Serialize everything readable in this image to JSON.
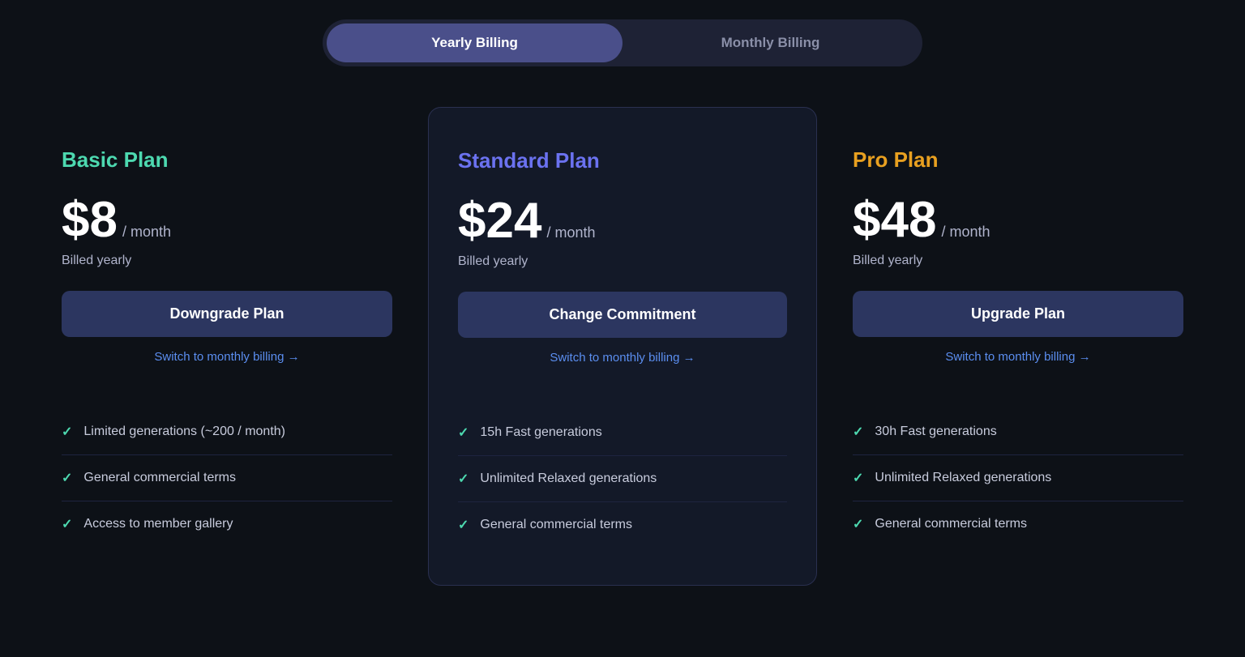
{
  "billing_toggle": {
    "yearly_label": "Yearly Billing",
    "monthly_label": "Monthly Billing"
  },
  "plans": [
    {
      "id": "basic",
      "name": "Basic Plan",
      "name_class": "basic",
      "price": "$8",
      "period": "/ month",
      "billed": "Billed yearly",
      "button_label": "Downgrade Plan",
      "button_class": "btn-downgrade",
      "switch_label": "Switch to monthly billing →",
      "features": [
        "Limited generations (~200 / month)",
        "General commercial terms",
        "Access to member gallery"
      ]
    },
    {
      "id": "standard",
      "name": "Standard Plan",
      "name_class": "standard",
      "price": "$24",
      "period": "/ month",
      "billed": "Billed yearly",
      "button_label": "Change Commitment",
      "button_class": "btn-change",
      "switch_label": "Switch to monthly billing →",
      "highlighted": true,
      "features": [
        "15h Fast generations",
        "Unlimited Relaxed generations",
        "General commercial terms"
      ]
    },
    {
      "id": "pro",
      "name": "Pro Plan",
      "name_class": "pro",
      "price": "$48",
      "period": "/ month",
      "billed": "Billed yearly",
      "button_label": "Upgrade Plan",
      "button_class": "btn-upgrade",
      "switch_label": "Switch to monthly billing →",
      "features": [
        "30h Fast generations",
        "Unlimited Relaxed generations",
        "General commercial terms"
      ]
    }
  ]
}
